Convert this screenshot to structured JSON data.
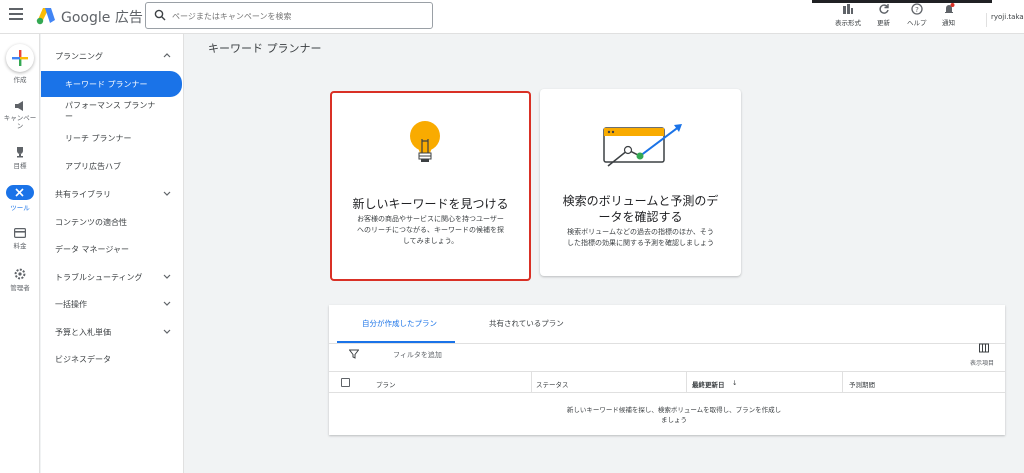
{
  "header": {
    "brand": "Google 広告",
    "search_placeholder": "ページまたはキャンペーンを検索",
    "tools": [
      {
        "label": "表示形式",
        "icon": "chart-icon"
      },
      {
        "label": "更新",
        "icon": "refresh-icon"
      },
      {
        "label": "ヘルプ",
        "icon": "help-icon"
      },
      {
        "label": "通知",
        "icon": "bell-icon"
      }
    ],
    "user": "ryoji.taka"
  },
  "rail": {
    "items": [
      {
        "label": "作成",
        "icon": "plus-icon"
      },
      {
        "label": "キャンペーン",
        "icon": "megaphone-icon"
      },
      {
        "label": "目標",
        "icon": "trophy-icon"
      },
      {
        "label": "ツール",
        "icon": "tools-icon"
      },
      {
        "label": "料金",
        "icon": "card-icon"
      },
      {
        "label": "管理者",
        "icon": "gear-icon"
      }
    ]
  },
  "sidenav": {
    "items": [
      {
        "label": "プランニング"
      },
      {
        "label": "キーワード プランナー"
      },
      {
        "label": "パフォーマンス プランナ"
      },
      {
        "label": "ー"
      },
      {
        "label": "リーチ プランナー"
      },
      {
        "label": "アプリ広告ハブ"
      },
      {
        "label": "共有ライブラリ"
      },
      {
        "label": "コンテンツの適合性"
      },
      {
        "label": "データ マネージャー"
      },
      {
        "label": "トラブルシューティング"
      },
      {
        "label": "一括操作"
      },
      {
        "label": "予算と入札単価"
      },
      {
        "label": "ビジネスデータ"
      }
    ]
  },
  "main": {
    "title": "キーワード プランナー",
    "cards": [
      {
        "title": "新しいキーワードを見つける",
        "desc1": "お客様の商品やサービスに関心を持つユーザー",
        "desc2": "へのリーチにつながる、キーワードの候補を探",
        "desc3": "してみましょう。"
      },
      {
        "title1": "検索のボリュームと予測のデ",
        "title2": "ータを確認する",
        "desc1": "検索ボリュームなどの過去の指標のほか、そう",
        "desc2": "した指標の効果に関する予測を確認しましょう"
      }
    ],
    "plans": {
      "tabs": [
        "自分が作成したプラン",
        "共有されているプラン"
      ],
      "filter_label": "フィルタを追加",
      "columns_label": "表示項目",
      "headers": [
        "プラン",
        "ステータス",
        "最終更新日",
        "予測期間"
      ],
      "sort_indicator": "↓",
      "empty1": "新しいキーワード候補を探し、検索ボリュームを取得し、プランを作成し",
      "empty2": "ましょう"
    }
  },
  "colors": {
    "accent": "#1a73e8",
    "highlight": "#d93025",
    "bulb": "#f9ab00"
  }
}
